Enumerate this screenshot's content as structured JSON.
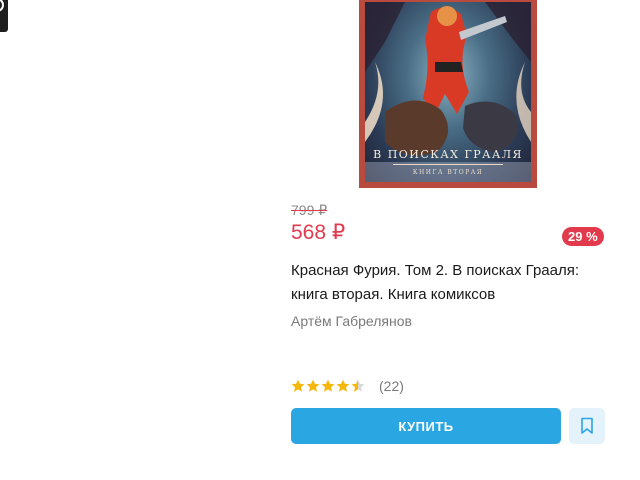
{
  "product": {
    "cover_title": "В ПОИСКАХ ГРААЛЯ",
    "cover_subtitle": "КНИГА ВТОРАЯ",
    "old_price": "799 ₽",
    "new_price": "568 ₽",
    "discount": "29 %",
    "title": "Красная Фурия. Том 2. В поисках Грааля: книга вторая. Книга комиксов",
    "author": "Артём Габрелянов",
    "rating": 4.5,
    "reviews": "(22)",
    "buy_label": "КУПИТЬ"
  },
  "colors": {
    "accent": "#2aa6e3",
    "price_red": "#e23a4d",
    "star": "#f5b70a",
    "star_empty": "#d9d9d9"
  }
}
